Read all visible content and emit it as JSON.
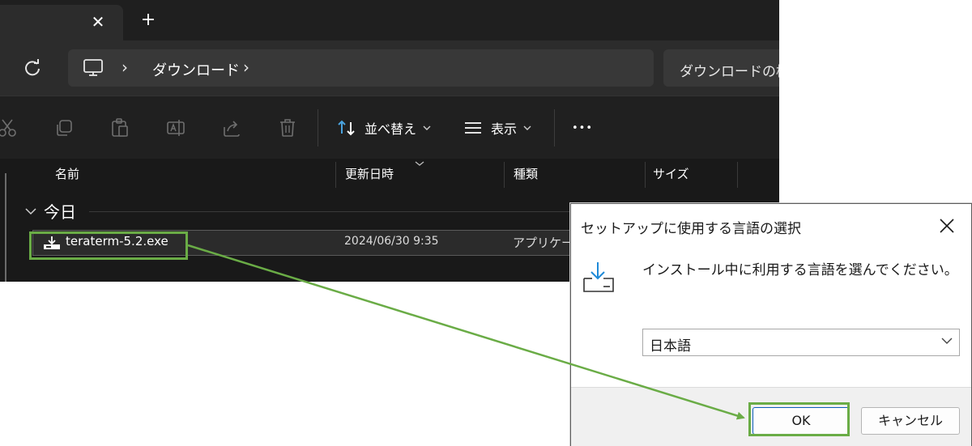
{
  "explorer": {
    "tab": {
      "close_glyph": "✕",
      "new_glyph": "+"
    },
    "address": {
      "separator": "›",
      "crumb": "ダウンロード",
      "search_text": "ダウンロードの検"
    },
    "toolbar": {
      "icons": [
        "cut-icon",
        "copy-icon",
        "paste-icon",
        "rename-icon",
        "share-icon",
        "delete-icon"
      ],
      "sort_label": "並べ替え",
      "view_label": "表示",
      "more_glyph": "•••"
    },
    "columns": [
      "名前",
      "更新日時",
      "種類",
      "サイズ"
    ],
    "group_label": "今日",
    "file": {
      "name": "teraterm-5.2.exe",
      "date": "2024/06/30 9:35",
      "type": "アプリケーション"
    }
  },
  "dialog": {
    "title": "セットアップに使用する言語の選択",
    "message": "インストール中に利用する言語を選んでください。",
    "language": "日本語",
    "ok_label": "OK",
    "cancel_label": "キャンセル"
  },
  "colors": {
    "highlight": "#6aac46",
    "explorer_bg": "#191919",
    "accent": "#4aa3df"
  }
}
